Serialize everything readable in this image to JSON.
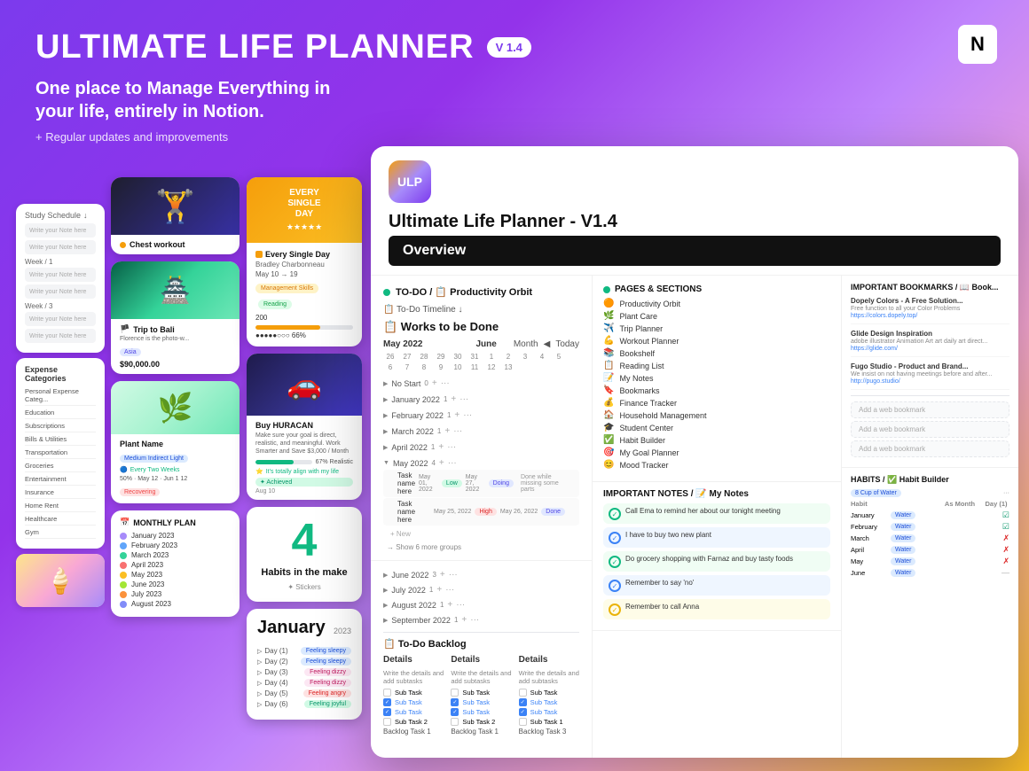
{
  "header": {
    "title": "ULTIMATE LIFE PLANNER",
    "version": "V 1.4",
    "subtitle": "One place to Manage Everything in your life, entirely in Notion.",
    "updates": "+ Regular updates and improvements"
  },
  "notion_icon": "N",
  "left_column": {
    "study_schedule": "Study Schedule",
    "note_placeholder": "Write your Note here",
    "week_labels": [
      "Week / 1",
      "Week / 3"
    ],
    "expense_categories": [
      "Personal Expense Categ...",
      "Education",
      "Subscriptions",
      "Bills & Utilities",
      "Transportation",
      "Groceries",
      "Entertainment",
      "Insurance",
      "Home Rent",
      "Healthcare",
      "Gym"
    ]
  },
  "workout_card": {
    "title": "Chest workout",
    "icon": "💪"
  },
  "bali_card": {
    "title": "Trip to Bali",
    "flag": "🏴",
    "desc": "Florence is the photo-w...",
    "tag": "Asia",
    "price": "$90,000.00"
  },
  "plant_card": {
    "name": "Plant Name",
    "water_badge": "Medium Indirect Light",
    "schedule": "Every Two Weeks",
    "stats": [
      "50%",
      "May 12",
      "Jun 1 12"
    ],
    "status": "Recovering"
  },
  "monthly_plan": {
    "title": "MONTHLY PLAN",
    "months": [
      {
        "label": "January 2023",
        "color": "#a78bfa"
      },
      {
        "label": "February 2023",
        "color": "#60a5fa"
      },
      {
        "label": "March 2023",
        "color": "#34d399"
      },
      {
        "label": "April 2023",
        "color": "#f87171"
      },
      {
        "label": "May 2023",
        "color": "#fbbf24"
      },
      {
        "label": "June 2023",
        "color": "#a3e635"
      },
      {
        "label": "July 2023",
        "color": "#fb923c"
      },
      {
        "label": "August 2023",
        "color": "#818cf8"
      }
    ]
  },
  "esd_card": {
    "header_text": "EVERY\nSINGLE\nDAY",
    "stars": "★★★★★",
    "book_title": "Every Single Day",
    "author": "Bradley Charbonneau",
    "dates": "May 10 → 19",
    "tag_mgmt": "Management Skills",
    "tag_reading": "Reading",
    "pages": "200",
    "progress_pct": 66,
    "progress_label": "●●●●●○○○ 66%"
  },
  "car_card": {
    "title": "Buy HURACAN",
    "desc": "Make sure your goal is direct, realistic, and meaningful. Work Smarter and Save $3,000 / Month",
    "progress_label": "67% Realistic",
    "affirmation": "It's totally align with my life",
    "achieved": "✦ Achieved",
    "date": "Aug 10"
  },
  "habits_card": {
    "number": "4",
    "label": "Habits in the make",
    "sticker": "✦ Stickers"
  },
  "january_card": {
    "title": "January",
    "year": "2023",
    "rows": [
      {
        "day": "Day (1)",
        "feeling": "Feeling sleepy",
        "type": "sleepy"
      },
      {
        "day": "Day (2)",
        "feeling": "Feeling sleepy",
        "type": "sleepy"
      },
      {
        "day": "Day (3)",
        "feeling": "Feeling dizzy",
        "type": "dizzy"
      },
      {
        "day": "Day (4)",
        "feeling": "Feeling dizzy",
        "type": "dizzy"
      },
      {
        "day": "Day (5)",
        "feeling": "Feeling angry",
        "type": "angry"
      },
      {
        "day": "Day (6)",
        "feeling": "Feeling joyful",
        "type": "joyful"
      }
    ]
  },
  "app": {
    "logo_text": "ULP",
    "title": "Ultimate Life Planner - V1.4",
    "overview_label": "Overview",
    "todo_heading": "TO-DO / 📋 Productivity Orbit",
    "timeline_label": "📋 To-Do Timeline ↓",
    "works_done_title": "📋 Works to be Done",
    "months_cal": [
      "May 2022",
      "June"
    ],
    "today_label": "Today",
    "month_label": "Month",
    "dates_row": [
      "26",
      "27",
      "28",
      "29",
      "30",
      "31",
      "1",
      "2",
      "3",
      "4",
      "5",
      "6",
      "7",
      "8",
      "9",
      "10",
      "11",
      "12",
      "13"
    ],
    "task_groups": [
      {
        "name": "No Start",
        "count": "0",
        "tasks": []
      },
      {
        "name": "January 2022",
        "count": "1",
        "tasks": []
      },
      {
        "name": "February 2022",
        "count": "1",
        "tasks": []
      },
      {
        "name": "March 2022",
        "count": "1",
        "tasks": []
      },
      {
        "name": "April 2022",
        "count": "1",
        "tasks": []
      },
      {
        "name": "May 2022",
        "count": "4",
        "tasks": [
          {
            "name": "Task name here",
            "date_start": "May 01, 2022",
            "priority": "Low",
            "date_end": "May 27, 2022",
            "status": "Doing"
          },
          {
            "name": "Task name here",
            "date_start": "May 25, 2022",
            "priority": "High",
            "date_end": "May 26, 2022",
            "status": "Done"
          }
        ]
      }
    ],
    "show_more": "→ Show 6 more groups",
    "new_label": "+ New",
    "month_groups_bottom": [
      {
        "name": "June 2022",
        "count": "3"
      },
      {
        "name": "July 2022",
        "count": "1"
      },
      {
        "name": "August 2022",
        "count": "1"
      },
      {
        "name": "September 2022",
        "count": "1"
      }
    ],
    "backlog_title": "📋 To-Do Backlog",
    "backlog_cols": [
      {
        "title": "Details",
        "desc": "Write the details and add subtasks",
        "subtasks": [
          "Sub Task",
          "Sub Task",
          "Sub Task 2"
        ]
      },
      {
        "title": "Details",
        "desc": "Write the details and add subtasks",
        "subtasks": [
          "Sub Task",
          "Sub Task",
          "Sub Task 2"
        ]
      },
      {
        "title": "Details",
        "desc": "Write the details and add subtasks",
        "subtasks": [
          "Sub Task",
          "Sub Task",
          "Sub Task 1"
        ]
      }
    ],
    "backlog_items": [
      "Backlog Task 1",
      "Backlog Task 1",
      "Backlog Task 3"
    ]
  },
  "pages_section": {
    "title": "PAGES & SECTIONS",
    "items": [
      {
        "icon": "🟠",
        "label": "Productivity Orbit"
      },
      {
        "icon": "🌿",
        "label": "Plant Care"
      },
      {
        "icon": "✈️",
        "label": "Trip Planner"
      },
      {
        "icon": "💪",
        "label": "Workout Planner"
      },
      {
        "icon": "📚",
        "label": "Bookshelf"
      },
      {
        "icon": "📋",
        "label": "Reading List"
      },
      {
        "icon": "📝",
        "label": "My Notes"
      },
      {
        "icon": "🔖",
        "label": "Bookmarks"
      },
      {
        "icon": "💰",
        "label": "Finance Tracker"
      },
      {
        "icon": "🏠",
        "label": "Household Management"
      },
      {
        "icon": "🎓",
        "label": "Student Center"
      },
      {
        "icon": "✅",
        "label": "Habit Builder"
      },
      {
        "icon": "🎯",
        "label": "My Goal Planner"
      },
      {
        "icon": "😊",
        "label": "Mood Tracker"
      }
    ]
  },
  "notes_section": {
    "title": "IMPORTANT NOTES / 📝 My Notes",
    "items": [
      {
        "text": "Call Ema to remind her about our tonight meeting",
        "color": "green"
      },
      {
        "text": "I have to buy two new plant",
        "color": "blue"
      },
      {
        "text": "Do grocery shopping with Farnaz and buy tasty foods",
        "color": "green"
      },
      {
        "text": "Remember to say 'no'",
        "color": "blue"
      },
      {
        "text": "Remember to call Anna",
        "color": "yellow"
      }
    ]
  },
  "bookmarks_section": {
    "title": "IMPORTANT BOOKMARKS / 📖 Book...",
    "items": [
      {
        "name": "Dopely Colors - A Free Solution to all your...",
        "desc": "Free function to all your Color Problems",
        "url": "https://colors.dopely.top/"
      },
      {
        "name": "Glide Design Inspiration",
        "desc": "adobe illustrator Animation Art art daily art direct...",
        "url": "https://glide.com/"
      },
      {
        "name": "Fugo Studio - Product and Brand Studio...",
        "desc": "We insist on not having meetings before and after...",
        "url": "http://pugo.studio/"
      }
    ],
    "add_labels": [
      "Add a web bookmark",
      "Add a web bookmark",
      "Add a web bookmark"
    ]
  },
  "habits_section": {
    "title": "HABITS / ✅ Habit Builder",
    "habit_name": "8 Cup of Water",
    "col_headers": [
      "Habit",
      "As Month",
      "Day (1)"
    ],
    "months": [
      {
        "name": "January",
        "status": "water",
        "check": true
      },
      {
        "name": "February",
        "status": "water",
        "check": true
      },
      {
        "name": "March",
        "status": "water",
        "check": false
      },
      {
        "name": "April",
        "status": "water",
        "check": false
      },
      {
        "name": "May",
        "status": "water",
        "check": false
      },
      {
        "name": "June",
        "status": "water",
        "check": null
      }
    ]
  }
}
